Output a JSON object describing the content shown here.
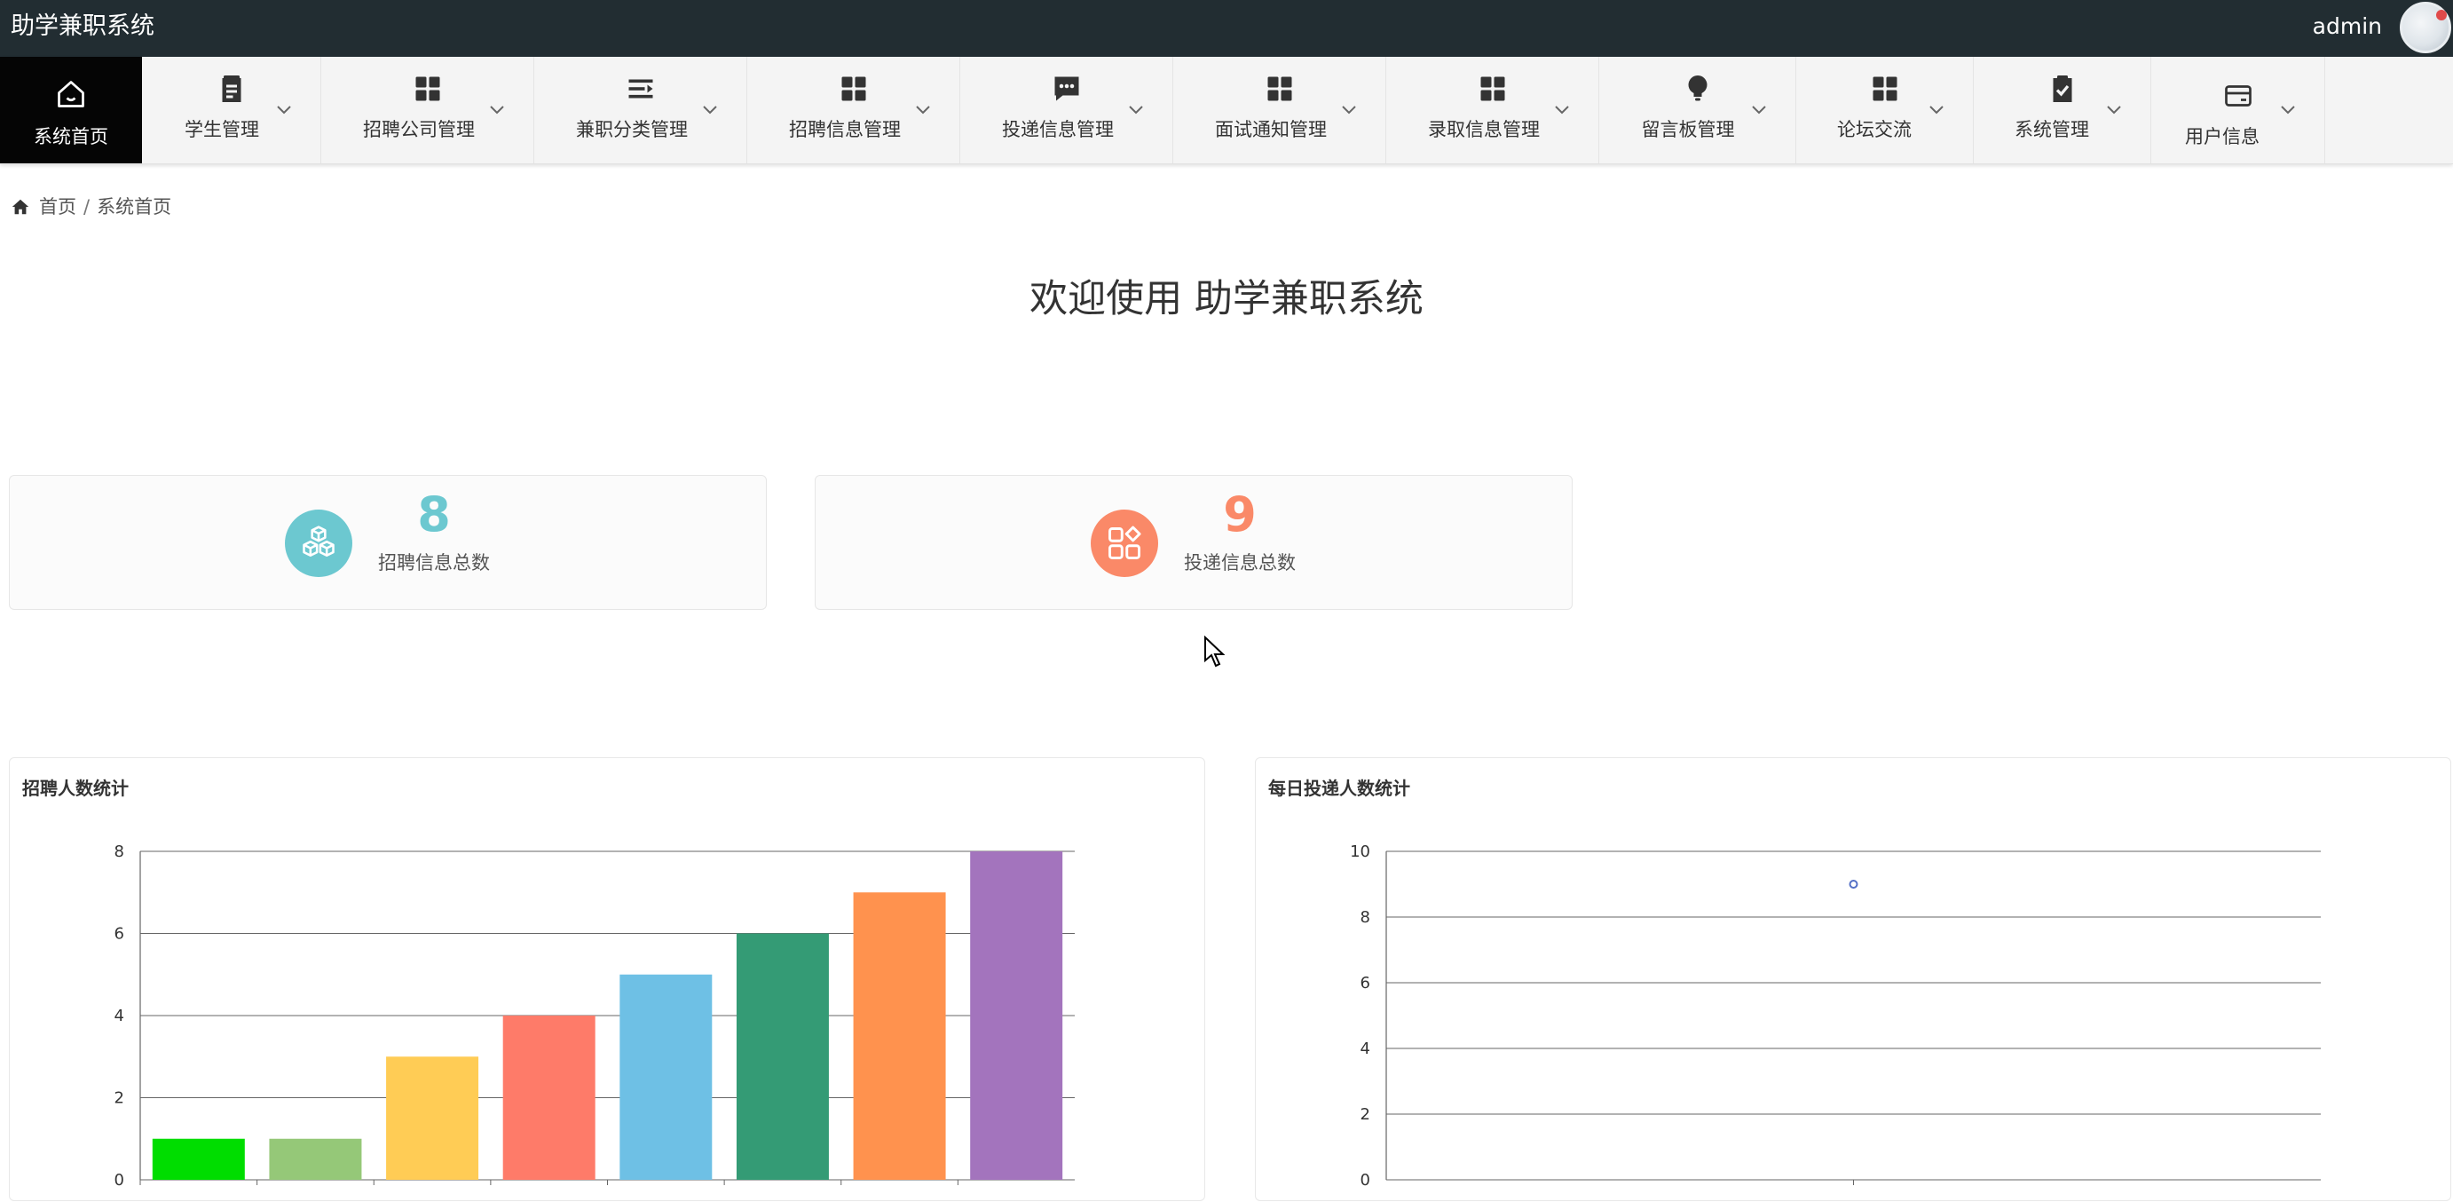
{
  "app": {
    "title": "助学兼职系统",
    "user": "admin"
  },
  "nav": {
    "items": [
      {
        "label": "系统首页",
        "icon": "home-icon",
        "active": true
      },
      {
        "label": "学生管理",
        "icon": "clipboard-icon"
      },
      {
        "label": "招聘公司管理",
        "icon": "grid-icon"
      },
      {
        "label": "兼职分类管理",
        "icon": "list-icon"
      },
      {
        "label": "招聘信息管理",
        "icon": "grid-icon"
      },
      {
        "label": "投递信息管理",
        "icon": "chat-icon"
      },
      {
        "label": "面试通知管理",
        "icon": "grid-icon"
      },
      {
        "label": "录取信息管理",
        "icon": "grid-icon"
      },
      {
        "label": "留言板管理",
        "icon": "bulb-icon"
      },
      {
        "label": "论坛交流",
        "icon": "grid-icon"
      },
      {
        "label": "系统管理",
        "icon": "clipboard-check-icon"
      },
      {
        "label": "用户信息",
        "icon": "card-icon"
      }
    ]
  },
  "breadcrumb": {
    "home": "首页",
    "separator": "/",
    "current": "系统首页"
  },
  "welcome": "欢迎使用 助学兼职系统",
  "stats": [
    {
      "value": "8",
      "label": "招聘信息总数",
      "color": "#6cc8d0"
    },
    {
      "value": "9",
      "label": "投递信息总数",
      "color": "#fa8968"
    }
  ],
  "charts": {
    "recruit": {
      "title": "招聘人数统计"
    },
    "daily": {
      "title": "每日投递人数统计"
    }
  },
  "chart_data": [
    {
      "type": "bar",
      "title": "招聘人数统计",
      "categories": [
        "",
        "",
        "",
        "",
        "",
        "",
        "",
        ""
      ],
      "values": [
        1,
        1,
        3,
        4,
        5,
        6,
        7,
        8
      ],
      "colors": [
        "#00dd00",
        "#95c878",
        "#ffcc55",
        "#fe7b69",
        "#6ec0e5",
        "#349b75",
        "#ff924e",
        "#a374bd"
      ],
      "ylim": [
        0,
        8
      ],
      "yticks": [
        0,
        2,
        4,
        6,
        8
      ],
      "grid": true
    },
    {
      "type": "scatter",
      "title": "每日投递人数统计",
      "x": [
        ""
      ],
      "values": [
        9
      ],
      "ylim": [
        0,
        10
      ],
      "yticks": [
        0,
        2,
        4,
        6,
        8,
        10
      ],
      "grid": true,
      "color": "#5470c6"
    }
  ]
}
